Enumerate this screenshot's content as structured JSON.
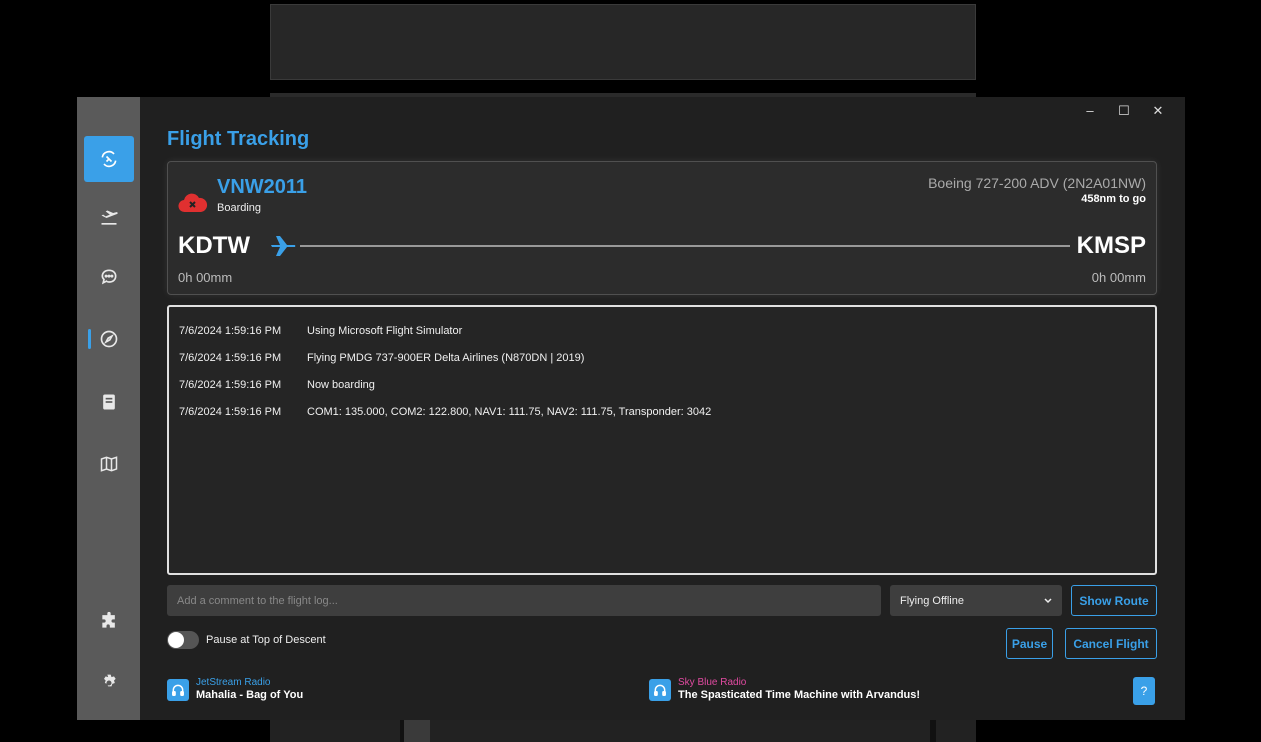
{
  "window": {
    "controls": [
      "–",
      "☐",
      "✕"
    ]
  },
  "title": "Flight Tracking",
  "flight": {
    "callsign": "VNW2011",
    "status": "Boarding",
    "aircraft": "Boeing 727-200 ADV (2N2A01NW)",
    "distance_to_go": "458nm to go",
    "departure": "KDTW",
    "arrival": "KMSP",
    "departure_time": "0h 00mm",
    "arrival_time": "0h 00mm"
  },
  "log": [
    {
      "time": "7/6/2024 1:59:16 PM",
      "message": "Using Microsoft Flight Simulator"
    },
    {
      "time": "7/6/2024 1:59:16 PM",
      "message": "Flying PMDG 737-900ER Delta Airlines (N870DN | 2019)"
    },
    {
      "time": "7/6/2024 1:59:16 PM",
      "message": "Now boarding"
    },
    {
      "time": "7/6/2024 1:59:16 PM",
      "message": "COM1: 135.000, COM2: 122.800, NAV1: 111.75, NAV2: 111.75, Transponder: 3042"
    }
  ],
  "controls": {
    "comment_placeholder": "Add a comment to the flight log...",
    "mode_selected": "Flying Offline",
    "show_route": "Show Route",
    "pause": "Pause",
    "cancel_flight": "Cancel Flight",
    "toggle_label": "Pause at Top of Descent",
    "help": "?"
  },
  "radios": [
    {
      "station": "JetStream Radio",
      "track": "Mahalia - Bag of You",
      "color": "#3aa0e8"
    },
    {
      "station": "Sky Blue Radio",
      "track": "The Spasticated Time Machine with Arvandus!",
      "color": "#e04aa0"
    }
  ],
  "sidebar": {
    "items": [
      "flight-tracking-icon",
      "departure-icon",
      "chat-icon",
      "compass-icon",
      "book-icon",
      "map-icon",
      "puzzle-icon",
      "gear-icon"
    ]
  },
  "colors": {
    "accent": "#3aa0e8",
    "sidebar": "#5a5a5a",
    "status_red": "#e03030"
  }
}
